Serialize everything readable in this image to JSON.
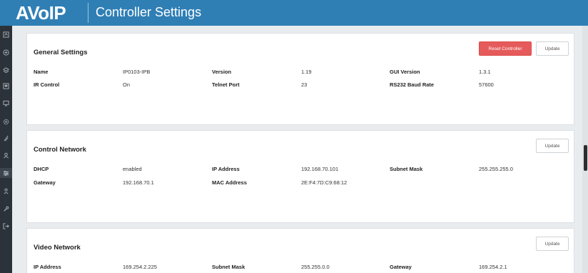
{
  "app": {
    "logo": "AVoIP",
    "title": "Controller Settings"
  },
  "sidebar": {
    "icons": [
      "dashboard-icon",
      "add-circle-icon",
      "layers-icon",
      "display-icon",
      "monitor-icon",
      "settings-gear-icon",
      "routing-icon",
      "user-icon",
      "sliders-icon",
      "upload-user-icon",
      "tools-icon",
      "logout-icon"
    ],
    "active": "sliders-icon"
  },
  "general": {
    "title": "General Settings",
    "reset_label": "Reset Controller",
    "update_label": "Update",
    "name_label": "Name",
    "name_value": "IP0103-IPB",
    "version_label": "Version",
    "version_value": "1.19",
    "gui_version_label": "GUI Version",
    "gui_version_value": "1.3.1",
    "ir_label": "IR Control",
    "ir_value": "On",
    "telnet_label": "Telnet Port",
    "telnet_value": "23",
    "baud_label": "RS232 Baud Rate",
    "baud_value": "57600"
  },
  "control_network": {
    "title": "Control Network",
    "update_label": "Update",
    "dhcp_label": "DHCP",
    "dhcp_value": "enabled",
    "ip_label": "IP Address",
    "ip_value": "192.168.70.101",
    "mask_label": "Subnet Mask",
    "mask_value": "255.255.255.0",
    "gateway_label": "Gateway",
    "gateway_value": "192.168.70.1",
    "mac_label": "MAC Address",
    "mac_value": "2E:F4:7D:C9:68:12"
  },
  "video_network": {
    "title": "Video Network",
    "update_label": "Update",
    "ip_label": "IP Address",
    "ip_value": "169.254.2.225",
    "mask_label": "Subnet Mask",
    "mask_value": "255.255.0.0",
    "gateway_label": "Gateway",
    "gateway_value": "169.254.2.1"
  },
  "colors": {
    "header": "#2f7fb5",
    "sidebar": "#2c3239",
    "reset": "#e55b5b",
    "background": "#e9ecef"
  }
}
